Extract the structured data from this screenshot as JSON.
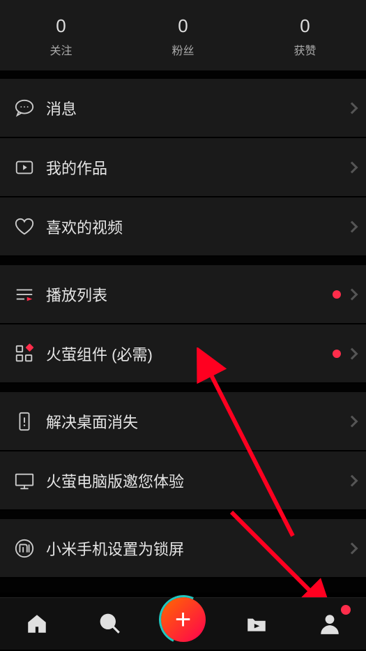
{
  "stats": {
    "follow": {
      "value": "0",
      "label": "关注"
    },
    "fans": {
      "value": "0",
      "label": "粉丝"
    },
    "likes": {
      "value": "0",
      "label": "获赞"
    }
  },
  "menu": {
    "messages": "消息",
    "my_works": "我的作品",
    "liked_videos": "喜欢的视频",
    "playlist": "播放列表",
    "widgets": "火萤组件 (必需)",
    "fix_desktop": "解决桌面消失",
    "pc_invite": "火萤电脑版邀您体验",
    "xiaomi_lock": "小米手机设置为锁屏"
  }
}
